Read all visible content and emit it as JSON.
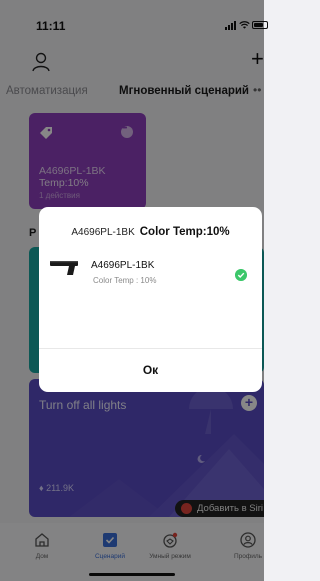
{
  "status_bar": {
    "time": "11:11"
  },
  "header": {
    "add_label": "+"
  },
  "tabs": [
    {
      "label": "Автоматизация"
    },
    {
      "label": "Мгновенный сценарий"
    }
  ],
  "tabs_more": "••",
  "scene_card": {
    "name": "A4696PL-1BK",
    "detail": "Temp:10%",
    "actions": "1 действия",
    "color": "#8e3fbd"
  },
  "section_letter": "Р",
  "teal_card": {
    "color": "#18a7a0"
  },
  "night_card": {
    "title": "Turn off all lights",
    "likes": "211.9K",
    "color": "#5a4cc4"
  },
  "siri": {
    "label": "Добавить в Siri"
  },
  "tabbar": [
    {
      "label": "Дом",
      "icon": "home-icon"
    },
    {
      "label": "Сценарий",
      "icon": "scenario-icon",
      "active": true
    },
    {
      "label": "Умный режим",
      "icon": "smart-mode-icon"
    },
    {
      "label": "Профиль",
      "icon": "profile-icon"
    }
  ],
  "dialog": {
    "title_model": "A4696PL-1BK",
    "title_value": "Color Temp:10%",
    "device_name": "A4696PL-1BK",
    "device_detail": "Color Temp : 10%",
    "ok_label": "Ок",
    "check_color": "#3cc76a"
  }
}
